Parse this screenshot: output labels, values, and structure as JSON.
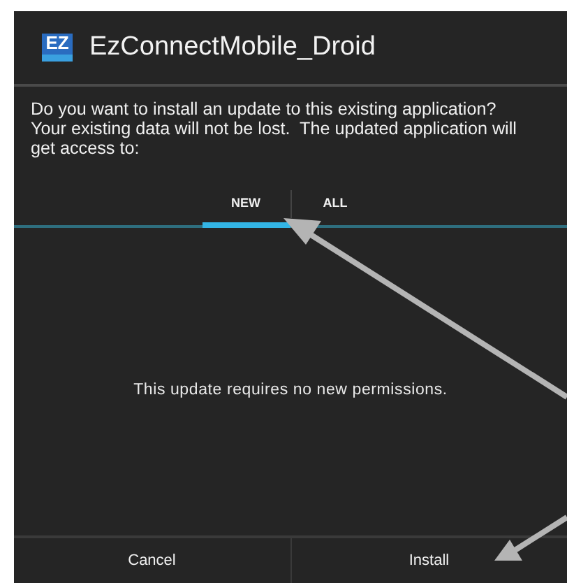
{
  "dialog": {
    "logo_text": "EZ",
    "title": "EzConnectMobile_Droid",
    "message": "Do you want to install an update to this existing application? Your existing data will not be lost.  The updated application will get access to:",
    "tabs": [
      {
        "label": "NEW",
        "selected": true
      },
      {
        "label": "ALL",
        "selected": false
      }
    ],
    "notice": "This update requires no new permissions.",
    "buttons": [
      "Cancel",
      "Install"
    ]
  }
}
